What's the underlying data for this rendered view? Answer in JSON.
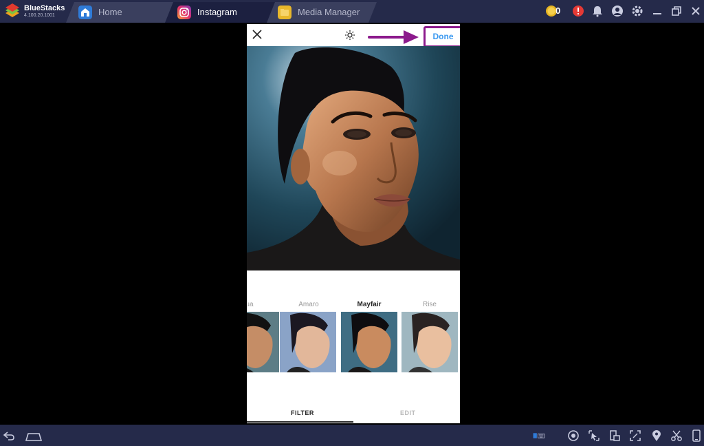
{
  "titlebar": {
    "brand_name": "BlueStacks",
    "brand_version": "4.100.20.1001",
    "tabs": [
      {
        "label": "Home",
        "icon": "home-icon"
      },
      {
        "label": "Instagram",
        "icon": "instagram-icon",
        "active": true
      },
      {
        "label": "Media Manager",
        "icon": "folder-icon"
      }
    ],
    "coin_count": "0",
    "right_icons": [
      "coin-icon",
      "alert-icon",
      "bell-icon",
      "profile-icon",
      "gear-icon",
      "minimize-icon",
      "restore-icon",
      "close-icon"
    ]
  },
  "instagram": {
    "header": {
      "close_icon": "close-icon",
      "brightness_icon": "brightness-icon",
      "done_label": "Done",
      "annotation_arrow_color": "#8c1a8c"
    },
    "filters": [
      {
        "name": "petua"
      },
      {
        "name": "Amaro"
      },
      {
        "name": "Mayfair",
        "selected": true
      },
      {
        "name": "Rise"
      }
    ],
    "bottom_tabs": [
      {
        "label": "FILTER",
        "active": true
      },
      {
        "label": "EDIT"
      }
    ],
    "accent_color": "#3897f0"
  },
  "bottombar": {
    "left_icons": [
      "back-icon",
      "home-icon"
    ],
    "right_icons": [
      "keyboard-icon",
      "camera-icon",
      "cursor-icon",
      "rotate-icon",
      "fullscreen-icon",
      "location-icon",
      "scissors-icon",
      "phone-icon"
    ]
  }
}
